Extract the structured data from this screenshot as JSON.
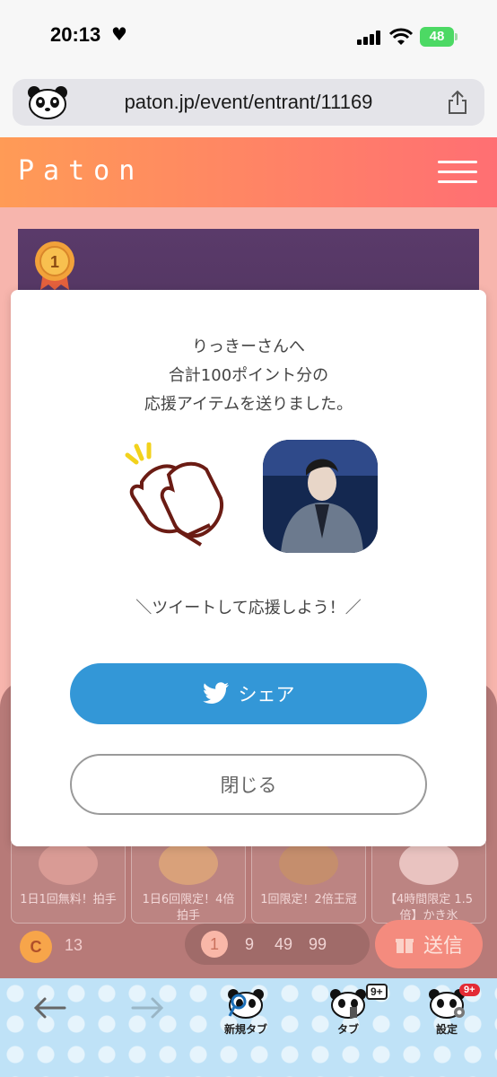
{
  "status": {
    "time": "20:13",
    "battery": "48"
  },
  "browser": {
    "url": "paton.jp/event/entrant/11169"
  },
  "site": {
    "logo": "Paton"
  },
  "modal": {
    "message_line1": "りっきーさんへ",
    "message_line2": "合計100ポイント分の",
    "message_line3": "応援アイテムを送りました。",
    "tweet_prompt": "＼ツイートして応援しよう！／",
    "share_label": "シェア",
    "close_label": "閉じる"
  },
  "rank_badge": "1",
  "items": [
    {
      "label": "1日1回無料！拍手"
    },
    {
      "label": "1日6回限定！4倍拍手"
    },
    {
      "label": "1回限定！2倍王冠"
    },
    {
      "label": "【4時間限定 1.5倍】かき氷"
    }
  ],
  "points": {
    "coin_symbol": "C",
    "coin_count": "13",
    "amounts": [
      "1",
      "9",
      "49",
      "99"
    ],
    "selected_amount": "1",
    "send_label": "送信"
  },
  "toolbar": {
    "new_tab": "新規タブ",
    "tabs": "タブ",
    "settings": "設定",
    "tab_count": "9+",
    "settings_badge": "9+"
  }
}
